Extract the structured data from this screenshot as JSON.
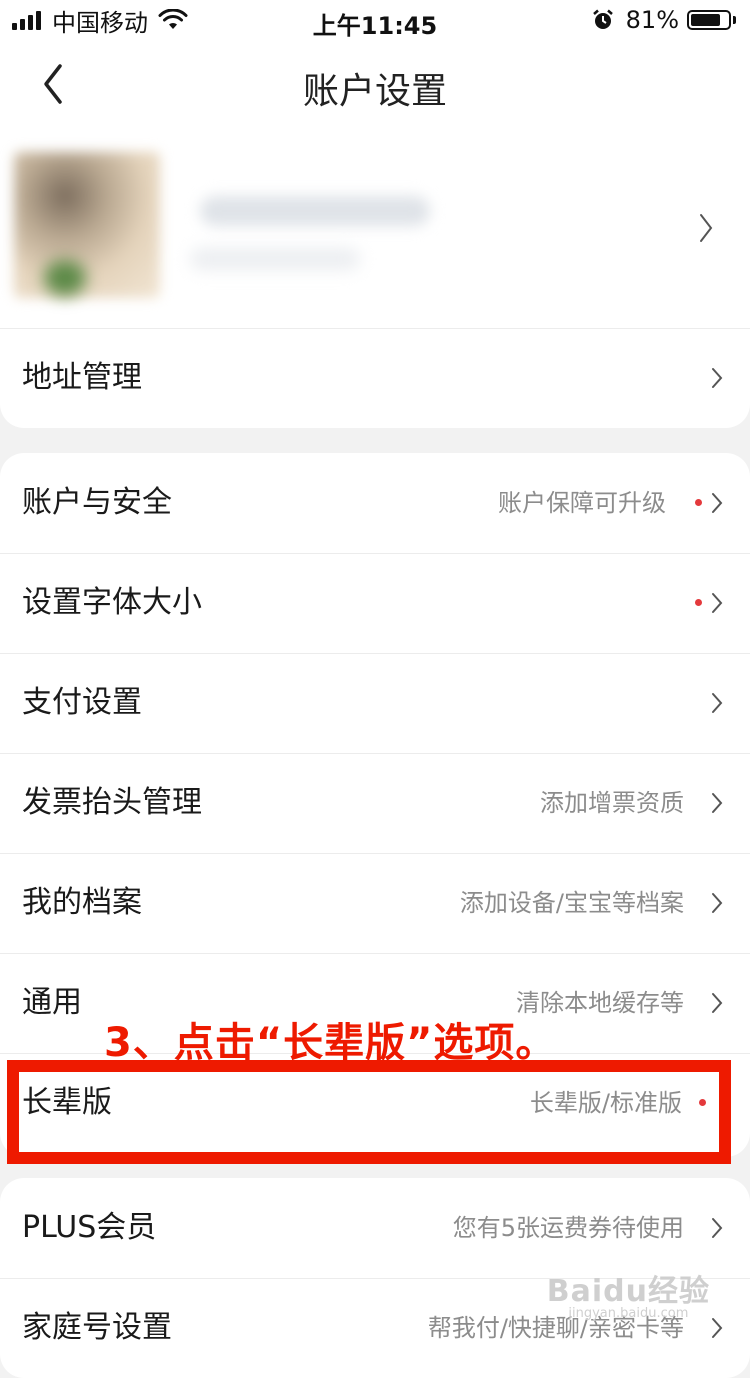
{
  "status_bar": {
    "carrier": "中国移动",
    "time": "上午11:45",
    "battery_percent": "81%",
    "battery_level": 0.81
  },
  "nav": {
    "title": "账户设置",
    "back_icon": "chevron-left-icon"
  },
  "profile": {
    "chevron_icon": "chevron-right-icon"
  },
  "group1": [
    {
      "label": "地址管理",
      "sub": "",
      "dot": false
    }
  ],
  "group2": [
    {
      "label": "账户与安全",
      "sub": "账户保障可升级",
      "dot": true
    },
    {
      "label": "设置字体大小",
      "sub": "",
      "dot": true
    },
    {
      "label": "支付设置",
      "sub": "",
      "dot": false
    },
    {
      "label": "发票抬头管理",
      "sub": "添加增票资质",
      "dot": false
    },
    {
      "label": "我的档案",
      "sub": "添加设备/宝宝等档案",
      "dot": false
    },
    {
      "label": "通用",
      "sub": "清除本地缓存等",
      "dot": false
    },
    {
      "label": "长辈版",
      "sub": "长辈版/标准版",
      "dot": true
    }
  ],
  "group3": [
    {
      "label": "PLUS会员",
      "sub": "您有5张运费券待使用",
      "dot": false
    },
    {
      "label": "家庭号设置",
      "sub": "帮我付/快捷聊/亲密卡等",
      "dot": false
    }
  ],
  "annotation": {
    "text": "3、点击“长辈版”选项。",
    "color": "#ee1a00"
  },
  "watermark": {
    "main": "Baidu经验",
    "url": "jingyan.baidu.com"
  },
  "colors": {
    "dot": "#e4393c",
    "sub_text": "#8c8c8c",
    "background": "#f2f2f2"
  }
}
